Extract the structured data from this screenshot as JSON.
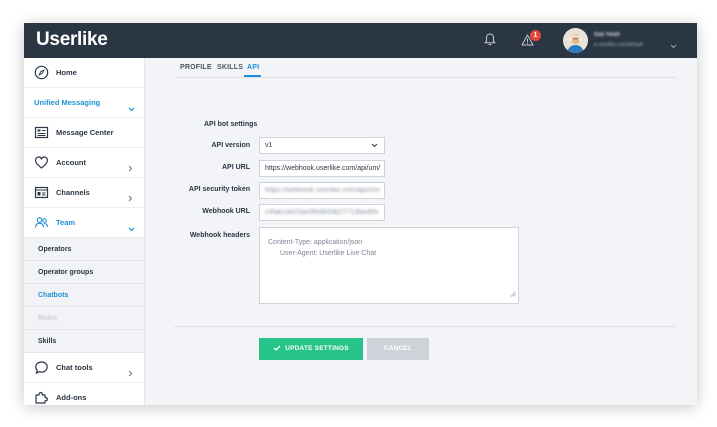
{
  "app": {
    "logo": "Userlike"
  },
  "topbar": {
    "alert_count": "1",
    "user_name": "Gül Yeoh",
    "user_status": "● userlike.com/default"
  },
  "sidebar": {
    "home": "Home",
    "unified_messaging": "Unified Messaging",
    "message_center": "Message Center",
    "account": "Account",
    "channels": "Channels",
    "team": "Team",
    "sub": {
      "operators": "Operators",
      "operator_groups": "Operator groups",
      "chatbots": "Chatbots",
      "roles": "Roles",
      "skills": "Skills"
    },
    "chat_tools": "Chat tools",
    "addons": "Add-ons"
  },
  "tabs": {
    "profile": "PROFILE",
    "skills": "SKILLS",
    "api": "API"
  },
  "form": {
    "section_title": "API bot settings",
    "api_version_label": "API version",
    "api_version_value": "v1",
    "api_url_label": "API URL",
    "api_url_value": "https://webhook.userlike.com/api/um/",
    "token_label": "API security token",
    "token_value": "https://webhook.userlike.com/api/um/",
    "webhook_url_label": "Webhook URL",
    "webhook_url_value": "c4fab1d425ae9f0d933b27713bedf0c",
    "headers_label": "Webhook headers",
    "headers_line1": "Content-Type: application/json",
    "headers_line2": "User-Agent: Userlike Live Chat"
  },
  "buttons": {
    "update": "UPDATE SETTINGS",
    "cancel": "CANCEL"
  },
  "colors": {
    "topbar": "#2b3644",
    "accent": "#1e8fd6",
    "save": "#27c48a",
    "cancel": "#cfd3d9",
    "badge": "#e8463c"
  }
}
